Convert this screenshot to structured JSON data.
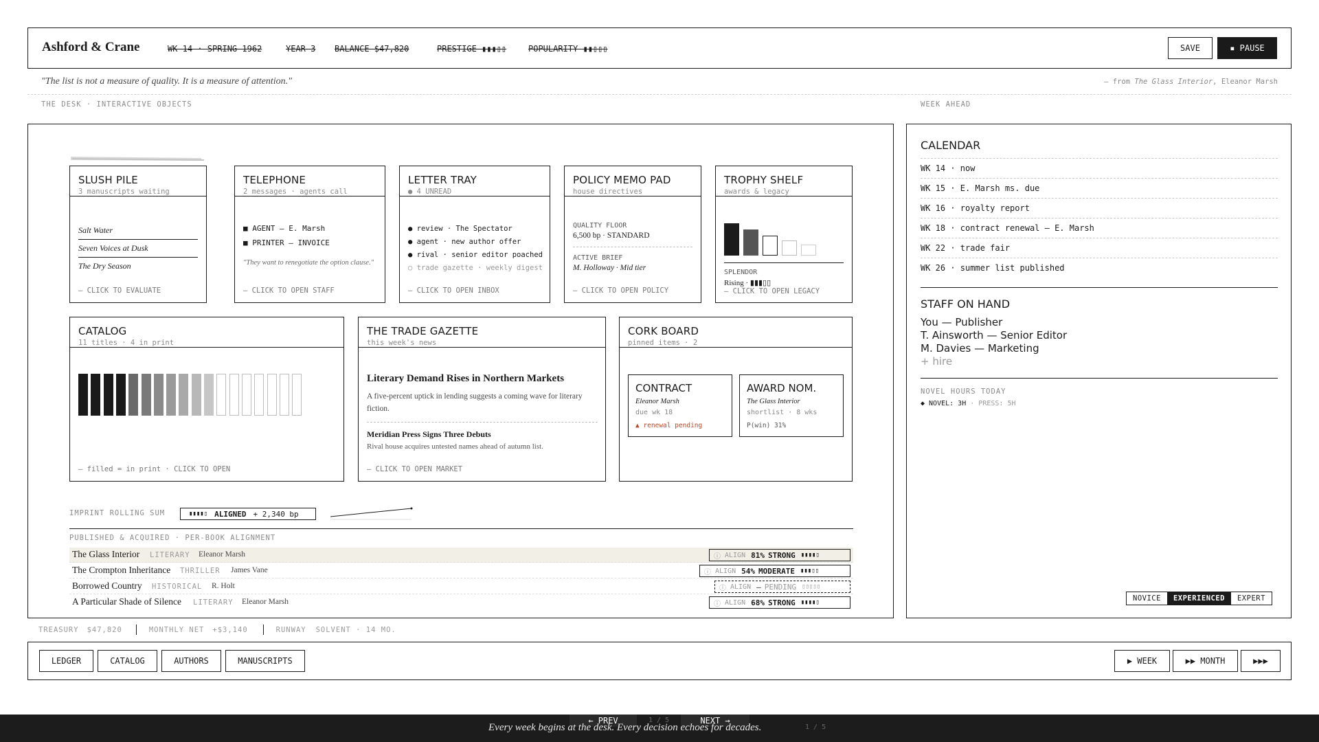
{
  "header": {
    "brand": "Ashford & Crane",
    "week": "WK 14 · SPRING 1962",
    "year": "YEAR 3",
    "balance": "BALANCE $47,820",
    "prestige": "PRESTIGE ▮▮▮▯▯",
    "popularity": "POPULARITY ▮▮▯▯▯",
    "save_label": "SAVE",
    "pause_label": "▪ PAUSE"
  },
  "quote": {
    "text": "\"The list is not a measure of quality. It is a measure of attention.\"",
    "from": "— from",
    "source_title": "The Glass Interior",
    "source_author": ", Eleanor Marsh"
  },
  "sections": {
    "desk": "THE DESK · INTERACTIVE OBJECTS",
    "week_ahead": "WEEK AHEAD"
  },
  "slush": {
    "title": "SLUSH PILE",
    "sub": "3 manuscripts waiting",
    "items": [
      "Salt Water",
      "Seven Voices at Dusk",
      "The Dry Season"
    ],
    "cta": "— CLICK TO EVALUATE"
  },
  "telephone": {
    "title": "TELEPHONE",
    "sub": "2 messages · agents call",
    "line1": "■ AGENT — E. Marsh",
    "line2": "■ PRINTER — INVOICE",
    "quote": "\"They want to renegotiate the option clause.\"",
    "cta": "— CLICK TO OPEN STAFF"
  },
  "letters": {
    "title": "LETTER TRAY",
    "sub": "● 4 UNREAD",
    "items": [
      "● review · The Spectator",
      "● agent · new author offer",
      "● rival · senior editor poached",
      "○ trade gazette · weekly digest"
    ],
    "cta": "— CLICK TO OPEN INBOX"
  },
  "memo": {
    "title": "POLICY MEMO PAD",
    "sub": "house directives",
    "floor_label": "QUALITY FLOOR",
    "floor_value": "6,500 bp · STANDARD",
    "brief_label": "ACTIVE BRIEF",
    "brief_value": "M. Holloway · Mid tier",
    "cta": "— CLICK TO OPEN POLICY"
  },
  "trophy": {
    "title": "TROPHY SHELF",
    "sub": "awards & legacy",
    "splendor_label": "SPLENDOR",
    "splendor_value": "Rising · ▮▮▮▯▯",
    "cta": "— CLICK TO OPEN LEGACY"
  },
  "catalog": {
    "title": "CATALOG",
    "sub": "11 titles · 4 in print",
    "total_titles": 18,
    "in_print": 4,
    "greyed": 7,
    "footer": "— filled = in print · CLICK TO OPEN"
  },
  "gazette": {
    "title": "THE TRADE GAZETTE",
    "sub": "this week's news",
    "headline": "Literary Demand Rises in Northern Markets",
    "body": "A five-percent uptick in lending suggests a coming wave for literary fiction.",
    "headline2": "Meridian Press Signs Three Debuts",
    "body2": "Rival house acquires untested names ahead of autumn list.",
    "cta": "— CLICK TO OPEN MARKET"
  },
  "cork": {
    "title": "CORK BOARD",
    "sub": "pinned items · 2",
    "contract": {
      "title": "CONTRACT",
      "author": "Eleanor Marsh",
      "due": "due wk 18",
      "note": "▲ renewal pending"
    },
    "award": {
      "title": "AWARD NOM.",
      "book": "The Glass Interior",
      "meta": "shortlist · 8 wks",
      "pwin": "P(win) 31%"
    }
  },
  "rolling": {
    "label": "IMPRINT ROLLING SUM",
    "bars": "▮▮▮▮▯",
    "status": "ALIGNED",
    "delta": "+ 2,340 bp"
  },
  "books": {
    "label": "PUBLISHED & ACQUIRED · PER-BOOK ALIGNMENT",
    "rows": [
      {
        "title": "The Glass Interior",
        "genre": "LITERARY",
        "author": "Eleanor Marsh",
        "icon": "ⓘ",
        "align": "ALIGN",
        "value": "81%",
        "rating": "STRONG",
        "bars": "▮▮▮▮▯"
      },
      {
        "title": "The Crompton Inheritance",
        "genre": "THRILLER",
        "author": "James Vane",
        "icon": "ⓘ",
        "align": "ALIGN",
        "value": "54%",
        "rating": "MODERATE",
        "bars": "▮▮▮▯▯"
      },
      {
        "title": "Borrowed Country",
        "genre": "HISTORICAL",
        "author": "R. Holt",
        "icon": "ⓘ",
        "align": "ALIGN",
        "value": "—",
        "rating": "PENDING",
        "bars": "▯▯▯▯▯"
      },
      {
        "title": "A Particular Shade of Silence",
        "genre": "LITERARY",
        "author": "Eleanor Marsh",
        "icon": "ⓘ",
        "align": "ALIGN",
        "value": "68%",
        "rating": "STRONG",
        "bars": "▮▮▮▮▯"
      }
    ]
  },
  "calendar": {
    "title": "CALENDAR",
    "rows": [
      "WK 14 · now",
      "WK 15 · E. Marsh ms. due",
      "WK 16 · royalty report",
      "WK 18 · contract renewal — E. Marsh",
      "WK 22 · trade fair",
      "WK 26 · summer list published"
    ]
  },
  "staff": {
    "title": "STAFF ON HAND",
    "members": [
      "You — Publisher",
      "T. Ainsworth — Senior Editor",
      "M. Davies — Marketing"
    ],
    "hire": "+ hire"
  },
  "hours": {
    "label": "NOVEL HOURS TODAY",
    "novel": "◆ NOVEL: 3H",
    "press": "· PRESS: 5H"
  },
  "difficulty": {
    "options": [
      "NOVICE",
      "EXPERIENCED",
      "EXPERT"
    ],
    "selected": "EXPERIENCED"
  },
  "status": {
    "treasury_label": "TREASURY",
    "treasury": "$47,820",
    "net_label": "MONTHLY NET",
    "net": "+$3,140",
    "runway_label": "RUNWAY",
    "runway": "SOLVENT · 14 MO."
  },
  "nav": {
    "ledger": "LEDGER",
    "catalog": "CATALOG",
    "authors": "AUTHORS",
    "manuscripts": "MANUSCRIPTS",
    "week": "▶ WEEK",
    "month": "▶▶ MONTH",
    "fast": "▶▶▶"
  },
  "footer": {
    "prev": "← PREV",
    "page": "1 / 5",
    "next": "NEXT →",
    "caption": "Every week begins at the desk. Every decision echoes for decades.",
    "page_right": "1 / 5"
  },
  "colors": {
    "ink": "#1a1a1a",
    "paper": "#ffffff",
    "highlight_row": "#f2efe6",
    "warning": "#b04a2a",
    "footer_bg": "#1c1c1c"
  }
}
